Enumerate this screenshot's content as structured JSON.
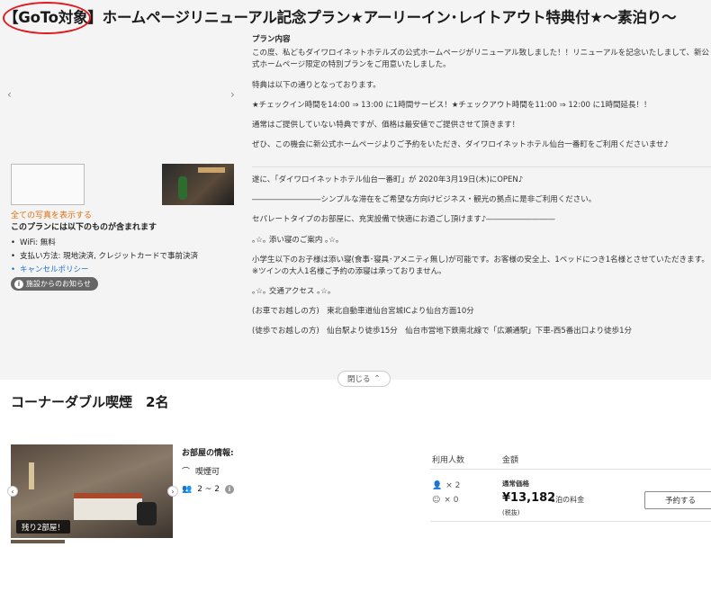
{
  "plan": {
    "title": "【GoTo対象】ホームページリニューアル記念プラン★アーリーイン･レイトアウト特典付★～素泊り～",
    "gallery_prev": "‹",
    "gallery_next": "›",
    "show_all_photos": "全ての写真を表示する",
    "includes_heading": "このプランには以下のものが含まれます",
    "includes": [
      "WiFi: 無料",
      "支払い方法: 現地決済, クレジットカードで事前決済",
      "キャンセルポリシー"
    ],
    "notice_button": "施設からのお知らせ",
    "content_heading": "プラン内容",
    "body": [
      "この度、私どもダイワロイネットホテルズの公式ホームページがリニューアル致しました！！リニューアルを記念いたしまして、新公式ホームページ限定の特別プランをご用意いたしました。",
      "特典は以下の通りとなっております。",
      "★チェックイン時間を14:00 ⇒ 13:00 に1時間サービス！★チェックアウト時間を11:00 ⇒ 12:00 に1時間延長！！",
      "通常はご提供していない特典ですが、価格は最安値でご提供させて頂きます！",
      "ぜひ、この機会に新公式ホームページよりご予約をいただき、ダイワロイネットホテル仙台一番町をご利用くださいませ♪"
    ],
    "body2": [
      "遂に、「ダイワロイネットホテル仙台一番町」が 2020年3月19日(木)にOPEN♪",
      "―――――――――シンプルな滞在をご希望な方向けビジネス・観光の拠点に是非ご利用ください。",
      "セパレートタイプのお部屋に、充実設備で快適にお過ごし頂けます♪―――――――――",
      "｡☆｡ 添い寝のご案内 ｡☆｡",
      "小学生以下のお子様は添い寝(食事･寝具･アメニティ無し)が可能です。お客様の安全上、1ベッドにつき1名様とさせていただきます。※ツインの大人1名様ご予約の添寝は承っておりません。",
      "｡☆｡ 交通アクセス ｡☆｡",
      "(お車でお越しの方)　東北自動車道仙台宮城ICより仙台方面10分",
      "(徒歩でお越しの方)　仙台駅より徒歩15分　仙台市営地下鉄南北線で「広瀬通駅」下車-西5番出口より徒歩1分"
    ],
    "close_button": "閉じる"
  },
  "room": {
    "title": "コーナーダブル喫煙　2名",
    "rooms_left": "残り2部屋！",
    "info_heading": "お部屋の情報:",
    "smoking": "喫煙可",
    "capacity": "2 ~ 2",
    "users_header": "利用人数",
    "amount_header": "金額",
    "adults": "× 2",
    "children": "× 0",
    "regular_price_label": "通常価格",
    "price": "¥13,182",
    "price_unit": "1泊の料金",
    "tax_note": "(税抜)",
    "reserve_button": "予約する"
  },
  "colors": {
    "highlight_circle": "#e0191e",
    "show_all_link": "#e07010",
    "policy_link": "#1a6fc4"
  }
}
